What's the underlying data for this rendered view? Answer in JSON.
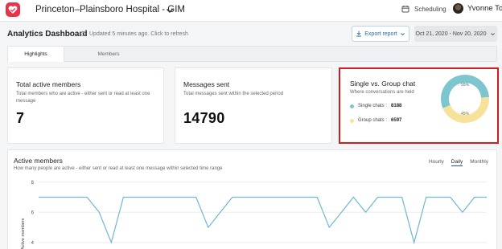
{
  "header": {
    "org_name": "Princeton–Plainsboro Hospital - GIM",
    "scheduling_label": "Scheduling",
    "user_name": "Yvonne To",
    "brand_color": "#e8334a"
  },
  "toolbar": {
    "page_title": "Analytics Dashboard",
    "refresh_text": "Updated 5 minutes ago. Click to refresh",
    "export_label": "Export report",
    "date_range": "Oct 21, 2020 - Nov 20, 2020"
  },
  "tabs": [
    {
      "label": "Highlights",
      "active": true
    },
    {
      "label": "Members",
      "active": false
    }
  ],
  "cards": {
    "active_members": {
      "title": "Total active members",
      "subtitle": "Total members who are active - either sent or read at least one message",
      "value": "7"
    },
    "messages_sent": {
      "title": "Messages sent",
      "subtitle": "Total messages sent within the selected period",
      "value": "14790"
    },
    "single_vs_group": {
      "title": "Single vs. Group chat",
      "subtitle": "Where conversations are held",
      "single_label": "Single chats :",
      "single_value": "8188",
      "group_label": "Group chats :",
      "group_value": "6597",
      "single_pct_label": "55%",
      "group_pct_label": "45%",
      "single_fraction": 0.554,
      "single_color": "#7ec6cf",
      "group_color": "#f8e29b"
    }
  },
  "active_chart": {
    "title": "Active members",
    "subtitle": "How many people are active - either sent or read at least one message within selected time range",
    "ranges": [
      {
        "label": "Hourly",
        "active": false
      },
      {
        "label": "Daily",
        "active": true
      },
      {
        "label": "Monthly",
        "active": false
      }
    ]
  },
  "chart_data": {
    "type": "line",
    "ylabel": "Active members",
    "yticks": [
      4,
      6,
      8
    ],
    "ylim": [
      3.3,
      8.2
    ],
    "grid": true,
    "line_color": "#6fb7d3",
    "series": [
      {
        "values": [
          7,
          7,
          7,
          7,
          7,
          6,
          4,
          7,
          7,
          7,
          7,
          7,
          7,
          7,
          5,
          6,
          7,
          7,
          7,
          7,
          7,
          7,
          7,
          7,
          5,
          6,
          7,
          6,
          7,
          7,
          7,
          4,
          7,
          7,
          7,
          6,
          7,
          7
        ]
      }
    ]
  }
}
